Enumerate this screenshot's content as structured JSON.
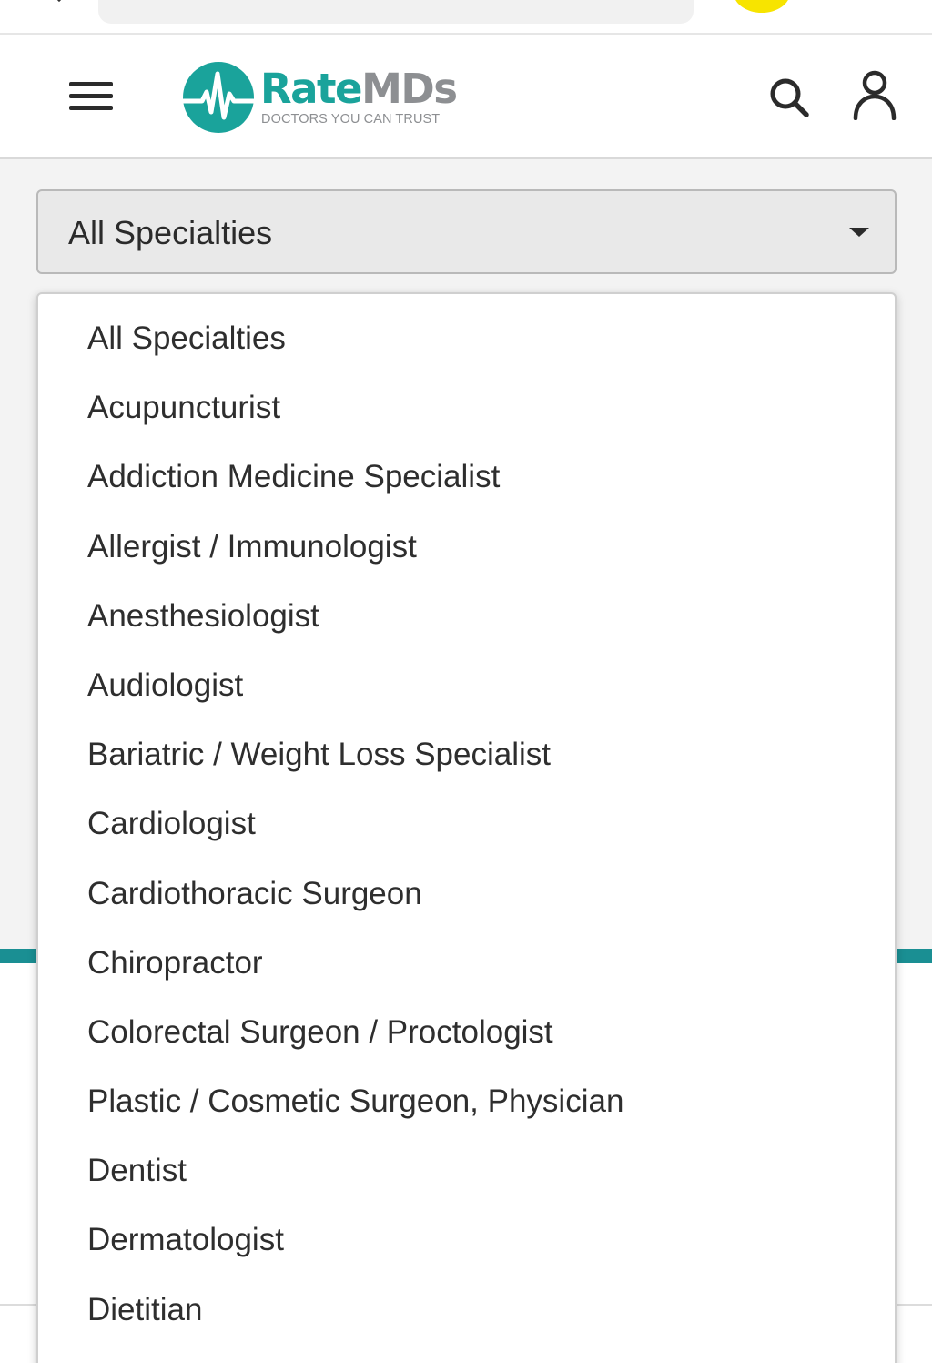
{
  "header": {
    "logo": {
      "word_rate": "Rate",
      "word_mds": "MDs",
      "tagline": "DOCTORS YOU CAN TRUST"
    },
    "icons": {
      "menu": "hamburger-menu-icon",
      "search": "search-icon",
      "account": "user-icon"
    }
  },
  "specialty_select": {
    "selected": "All Specialties",
    "options": [
      "All Specialties",
      "Acupuncturist",
      "Addiction Medicine Specialist",
      "Allergist / Immunologist",
      "Anesthesiologist",
      "Audiologist",
      "Bariatric / Weight Loss Specialist",
      "Cardiologist",
      "Cardiothoracic Surgeon",
      "Chiropractor",
      "Colorectal Surgeon / Proctologist",
      "Plastic / Cosmetic Surgeon, Physician",
      "Dentist",
      "Dermatologist",
      "Dietitian"
    ]
  },
  "colors": {
    "brand_teal": "#1aa39b",
    "brand_gray": "#8d8f92",
    "accent_bar": "#1a8f93",
    "browser_badge_yellow": "#f7e400"
  }
}
